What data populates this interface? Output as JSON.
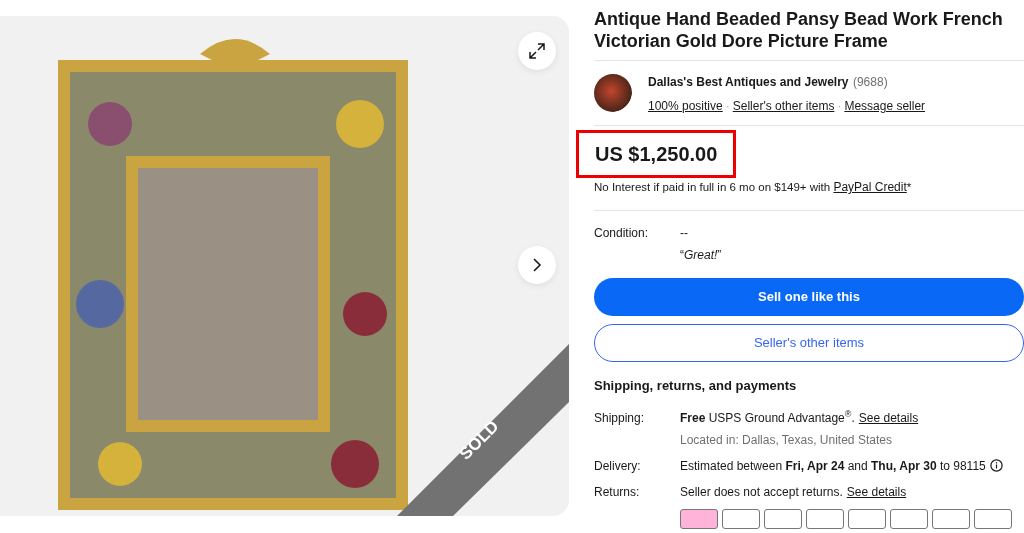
{
  "gallery": {
    "sold": true,
    "sold_label": "SOLD"
  },
  "title": "Antique Hand Beaded Pansy Bead Work French Victorian Gold Dore Picture Frame",
  "seller": {
    "name": "Dallas's Best Antiques and Jewelry",
    "feedback_count": "(9688)",
    "links": [
      "100% positive",
      "Seller's other items",
      "Message seller"
    ],
    "separator": "·"
  },
  "price": {
    "amount": "US $1,250.00",
    "highlighted": true,
    "financing": "No Interest if paid in full in 6 mo on $149+ with",
    "financing_link": "PayPal Credit",
    "financing_mark": "*"
  },
  "condition": {
    "label": "Condition:",
    "value": "--",
    "note": "“*Great!*”"
  },
  "buttons": [
    {
      "label": "Sell one like this",
      "kind": "primary"
    },
    {
      "label": "Seller's other items",
      "kind": "secondary"
    }
  ],
  "shipping": {
    "heading": "Shipping, returns, and payments",
    "rows": [
      {
        "label": "Shipping:",
        "text": "**Free** USPS Ground Advantage$^{®}$.",
        "link": "See details",
        "sub": "Located in: Dallas, Texas, United States",
        "info": false
      },
      {
        "label": "Delivery:",
        "text": "Estimated between **Fri, Apr 24** and **Thu, Apr 30** to 98115",
        "info": true
      },
      {
        "label": "Returns:",
        "text": "Seller does not accept returns.",
        "link": "See details",
        "info": false
      }
    ],
    "payment_methods": [
      {
        "color": "#ffb3d9"
      },
      {
        "color": "#ffffff"
      },
      {
        "color": "#ffffff"
      },
      {
        "color": "#ffffff"
      },
      {
        "color": "#ffffff"
      },
      {
        "color": "#ffffff"
      },
      {
        "color": "#ffffff"
      },
      {
        "color": "#ffffff"
      }
    ]
  }
}
